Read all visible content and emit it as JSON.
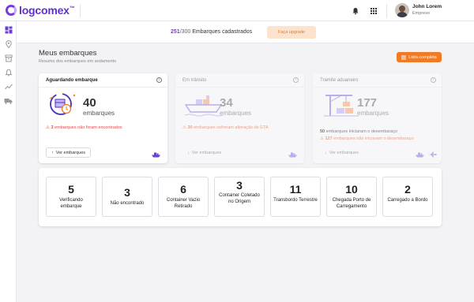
{
  "brand": {
    "name": "logcomex",
    "trademark": "™"
  },
  "user": {
    "name": "John Lorem",
    "company": "Empreso"
  },
  "plan": {
    "used": "251",
    "total": "/300",
    "suffix": " Embarques cadastrados",
    "upgrade_label": "Faça upgrade"
  },
  "page": {
    "title": "Meus embarques",
    "subtitle": "Resumo dos embarques em andamento",
    "list_button": "Lista completa"
  },
  "cards": [
    {
      "title": "Aguardando embarque",
      "count": "40",
      "count_label": "embarques",
      "alert_count": "3",
      "alert_text": " embarques não foram encontrados",
      "button": "Ver embarques",
      "illustration": "clock-box-icon",
      "mode_icons": [
        "ship-icon"
      ]
    },
    {
      "title": "Em trânsito",
      "count": "34",
      "count_label": "embarques",
      "alert_count": "30",
      "alert_text": " embarques sofreram alteração de ETA",
      "button": "Ver embarques",
      "illustration": "container-ship-icon",
      "mode_icons": [
        "ship-icon"
      ]
    },
    {
      "title": "Tramite aduaneiro",
      "count": "177",
      "count_label": "embarques",
      "info_count": "50",
      "info_text": " embarques iniciaram o desembaraço",
      "alert_count": "127",
      "alert_text": " embarques não iniciaram o desembaraço",
      "button": "Ver embarques",
      "illustration": "port-crane-icon",
      "mode_icons": [
        "ship-icon",
        "plane-icon"
      ]
    }
  ],
  "steps": [
    {
      "count": "5",
      "label": "Verificando embarque"
    },
    {
      "count": "3",
      "label": "Não encontrado"
    },
    {
      "count": "6",
      "label": "Container Vazio Retirado"
    },
    {
      "count": "3",
      "label": "Container Coletado no Origem"
    },
    {
      "count": "11",
      "label": "Transbordo Terrestre"
    },
    {
      "count": "10",
      "label": "Chegada Porto de Carregamento"
    },
    {
      "count": "2",
      "label": "Carregado a Bordo"
    }
  ],
  "colors": {
    "brand": "#7a38e8",
    "accent": "#f17a25",
    "alert": "#e04848",
    "upgrade_bg": "#fde3cd"
  },
  "sidebar_icons": [
    "dashboard-icon",
    "location-pin-icon",
    "archive-icon",
    "alarm-icon",
    "trend-icon",
    "truck-icon"
  ]
}
